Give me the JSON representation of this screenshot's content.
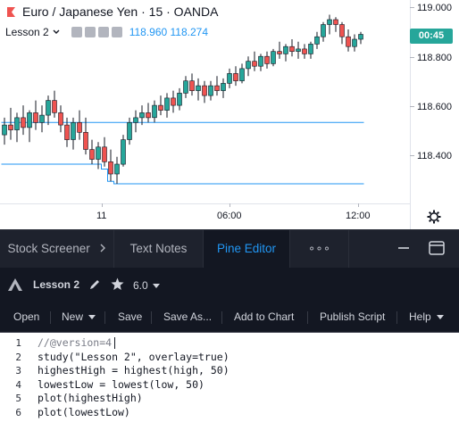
{
  "colors": {
    "bull": "#26a69a",
    "bear": "#ef5350",
    "study_line": "#2196f3",
    "accent": "#2196f3",
    "panel_bg": "#131722"
  },
  "chart": {
    "symbol_title": "Euro / Japanese Yen · 15 · OANDA",
    "study_name": "Lesson 2",
    "study_values": "118.960 118.274",
    "last_price_badge": "00:45",
    "price_labels": [
      "119.000",
      "118.800",
      "118.600",
      "118.400"
    ],
    "time_labels": [
      "11",
      "06:00",
      "12:00"
    ]
  },
  "chart_data": {
    "type": "line",
    "title": "Euro / Japanese Yen · 15 · OANDA",
    "ylim": [
      118.2,
      119.03
    ],
    "y_ticks": [
      118.4,
      118.6,
      118.8,
      119.0
    ],
    "x_ticks": [
      "11",
      "06:00",
      "12:00"
    ],
    "grid": false,
    "series": [
      {
        "name": "",
        "style": "candlestick",
        "values": [
          [
            118.48,
            118.55,
            118.44,
            118.52
          ],
          [
            118.52,
            118.59,
            118.46,
            118.5
          ],
          [
            118.5,
            118.57,
            118.45,
            118.55
          ],
          [
            118.55,
            118.6,
            118.48,
            118.51
          ],
          [
            118.51,
            118.58,
            118.45,
            118.57
          ],
          [
            118.57,
            118.62,
            118.5,
            118.53
          ],
          [
            118.53,
            118.6,
            118.49,
            118.56
          ],
          [
            118.56,
            118.64,
            118.52,
            118.62
          ],
          [
            118.62,
            118.66,
            118.55,
            118.57
          ],
          [
            118.57,
            118.6,
            118.49,
            118.52
          ],
          [
            118.52,
            118.55,
            118.43,
            118.46
          ],
          [
            118.46,
            118.55,
            118.42,
            118.53
          ],
          [
            118.53,
            118.58,
            118.46,
            118.49
          ],
          [
            118.49,
            118.55,
            118.4,
            118.42
          ],
          [
            118.42,
            118.46,
            118.36,
            118.38
          ],
          [
            118.38,
            118.45,
            118.34,
            118.43
          ],
          [
            118.43,
            118.47,
            118.35,
            118.37
          ],
          [
            118.37,
            118.42,
            118.29,
            118.32
          ],
          [
            118.32,
            118.39,
            118.28,
            118.36
          ],
          [
            118.36,
            118.48,
            118.35,
            118.46
          ],
          [
            118.46,
            118.55,
            118.44,
            118.53
          ],
          [
            118.53,
            118.58,
            118.49,
            118.55
          ],
          [
            118.55,
            118.6,
            118.52,
            118.57
          ],
          [
            118.57,
            118.61,
            118.53,
            118.55
          ],
          [
            118.55,
            118.62,
            118.53,
            118.6
          ],
          [
            118.6,
            118.64,
            118.56,
            118.58
          ],
          [
            118.58,
            118.65,
            118.55,
            118.63
          ],
          [
            118.63,
            118.66,
            118.57,
            118.6
          ],
          [
            118.6,
            118.67,
            118.58,
            118.65
          ],
          [
            118.65,
            118.72,
            118.63,
            118.7
          ],
          [
            118.7,
            118.73,
            118.64,
            118.66
          ],
          [
            118.66,
            118.71,
            118.62,
            118.68
          ],
          [
            118.68,
            118.7,
            118.61,
            118.64
          ],
          [
            118.64,
            118.7,
            118.62,
            118.68
          ],
          [
            118.68,
            118.72,
            118.64,
            118.66
          ],
          [
            118.66,
            118.71,
            118.63,
            118.69
          ],
          [
            118.69,
            118.75,
            118.67,
            118.73
          ],
          [
            118.73,
            118.76,
            118.68,
            118.7
          ],
          [
            118.7,
            118.77,
            118.69,
            118.75
          ],
          [
            118.75,
            118.8,
            118.72,
            118.78
          ],
          [
            118.78,
            118.82,
            118.74,
            118.76
          ],
          [
            118.76,
            118.81,
            118.74,
            118.8
          ],
          [
            118.8,
            118.82,
            118.75,
            118.77
          ],
          [
            118.77,
            118.83,
            118.76,
            118.82
          ],
          [
            118.82,
            118.86,
            118.79,
            118.81
          ],
          [
            118.81,
            118.85,
            118.78,
            118.84
          ],
          [
            118.84,
            118.87,
            118.8,
            118.82
          ],
          [
            118.82,
            118.86,
            118.79,
            118.83
          ],
          [
            118.83,
            118.85,
            118.79,
            118.81
          ],
          [
            118.81,
            118.86,
            118.79,
            118.85
          ],
          [
            118.85,
            118.9,
            118.83,
            118.88
          ],
          [
            118.88,
            118.94,
            118.86,
            118.93
          ],
          [
            118.93,
            118.97,
            118.89,
            118.95
          ],
          [
            118.95,
            118.96,
            118.9,
            118.93
          ],
          [
            118.93,
            118.94,
            118.85,
            118.88
          ],
          [
            118.88,
            118.91,
            118.82,
            118.84
          ],
          [
            118.84,
            118.89,
            118.82,
            118.87
          ],
          [
            118.87,
            118.9,
            118.85,
            118.89
          ]
        ]
      },
      {
        "name": "",
        "values": [
          118.53,
          118.53,
          118.53,
          118.53,
          118.53,
          118.53,
          118.53,
          118.53,
          118.53,
          118.53,
          118.53,
          118.53,
          118.53,
          118.53,
          118.53,
          118.53,
          118.53,
          118.53,
          118.53,
          118.53,
          118.53,
          118.53,
          118.53,
          118.53,
          118.53,
          118.53,
          118.53,
          118.53,
          118.53,
          118.53,
          118.53,
          118.53,
          118.53,
          118.53,
          118.53,
          118.53,
          118.53,
          118.53,
          118.53,
          118.53,
          118.53,
          118.53,
          118.53,
          118.53,
          118.53,
          118.53,
          118.53,
          118.53,
          118.53,
          118.53,
          118.53,
          118.53,
          118.53,
          118.53,
          118.53,
          118.53,
          118.53,
          118.53
        ]
      },
      {
        "name": "",
        "values": [
          118.36,
          118.36,
          118.36,
          118.36,
          118.36,
          118.36,
          118.36,
          118.36,
          118.36,
          118.36,
          118.36,
          118.36,
          118.36,
          118.36,
          118.36,
          118.36,
          118.34,
          118.29,
          118.28,
          118.28,
          118.28,
          118.28,
          118.28,
          118.28,
          118.28,
          118.28,
          118.28,
          118.28,
          118.28,
          118.28,
          118.28,
          118.28,
          118.28,
          118.28,
          118.28,
          118.28,
          118.28,
          118.28,
          118.28,
          118.28,
          118.28,
          118.28,
          118.28,
          118.28,
          118.28,
          118.28,
          118.28,
          118.28,
          118.28,
          118.28,
          118.28,
          118.28,
          118.28,
          118.28,
          118.28,
          118.28,
          118.28,
          118.28
        ]
      }
    ]
  },
  "tabs": [
    {
      "label": "Stock Screener"
    },
    {
      "label": "Text Notes"
    },
    {
      "label": "Pine Editor"
    },
    {
      "label": "∘∘∘"
    }
  ],
  "editor": {
    "script_title": "Lesson 2",
    "version": "6.0",
    "toolbar": {
      "open": "Open",
      "new": "New",
      "save": "Save",
      "save_as": "Save As...",
      "add_to_chart": "Add to Chart",
      "publish": "Publish Script",
      "help": "Help"
    },
    "line_numbers": [
      "1",
      "2",
      "3",
      "4",
      "5",
      "6"
    ],
    "code_lines": [
      "//@version=4",
      "study(\"Lesson 2\", overlay=true)",
      "highestHigh = highest(high, 50)",
      "lowestLow = lowest(low, 50)",
      "plot(highestHigh)",
      "plot(lowestLow)"
    ]
  }
}
